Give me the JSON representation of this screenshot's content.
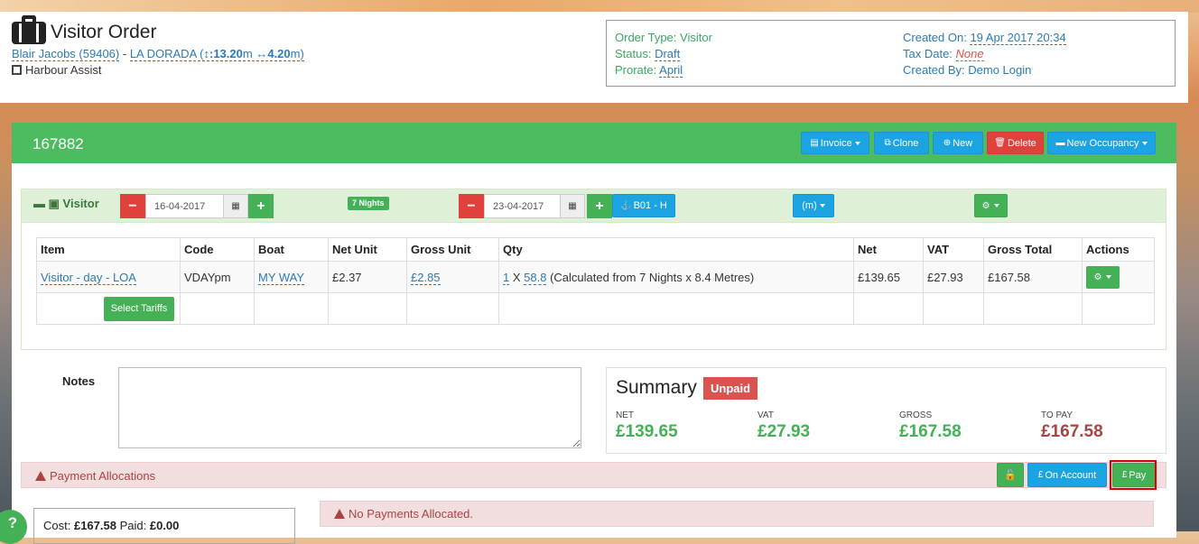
{
  "header": {
    "title": "Visitor Order",
    "customer_link": "Blair Jacobs (59406)",
    "separator": "-",
    "boat_link": "LA DORADA",
    "boat_dims_open": "(",
    "length_icon": "↕",
    "length": ":13.20",
    "length_unit": "m",
    "beam_icon": "↔",
    "beam": "4.20",
    "beam_unit": "m",
    "dims_close": ")",
    "company": "Harbour Assist",
    "info": {
      "order_type_label": "Order Type: Visitor",
      "status_label": "Status:",
      "status_value": "Draft",
      "prorate_label": "Prorate:",
      "prorate_value": "April",
      "created_on_label": "Created On:",
      "created_on_value": "19 Apr 2017 20:34",
      "tax_date_label": "Tax Date:",
      "tax_date_value": "None",
      "created_by_label": "Created By: Demo Login"
    }
  },
  "order": {
    "number": "167882",
    "buttons": {
      "invoice": "Invoice",
      "clone": "Clone",
      "new": "New",
      "delete": "Delete",
      "new_occupancy": "New Occupancy"
    }
  },
  "booking": {
    "label": "Visitor",
    "start_date": "16-04-2017",
    "end_date": "23-04-2017",
    "nights_badge": "7 Nights",
    "berth": "B01 - H",
    "unit_dropdown": "(m)",
    "minus": "−",
    "plus": "+"
  },
  "items_table": {
    "headers": [
      "Item",
      "Code",
      "Boat",
      "Net Unit",
      "Gross Unit",
      "Qty",
      "Net",
      "VAT",
      "Gross Total",
      "Actions"
    ],
    "row": {
      "item": "Visitor - day - LOA",
      "code": "VDAYpm",
      "boat": "MY WAY",
      "net_unit": "£2.37",
      "gross_unit": "£2.85",
      "qty_count": "1",
      "qty_x": "X",
      "qty_value": "58.8",
      "qty_note": "(Calculated from 7 Nights x 8.4 Metres)",
      "net": "£139.65",
      "vat": "£27.93",
      "gross_total": "£167.58"
    },
    "select_tariffs": "Select Tariffs"
  },
  "notes": {
    "label": "Notes",
    "value": ""
  },
  "summary": {
    "title": "Summary",
    "badge": "Unpaid",
    "net_label": "NET",
    "net_value": "£139.65",
    "vat_label": "VAT",
    "vat_value": "£27.93",
    "gross_label": "GROSS",
    "gross_value": "£167.58",
    "topay_label": "TO PAY",
    "topay_value": "£167.58"
  },
  "payments": {
    "title": "Payment Allocations",
    "on_account": "On Account",
    "pay": "Pay",
    "cost_label": "Cost:",
    "cost_value": "£167.58",
    "paid_label": "Paid:",
    "paid_value": "£0.00",
    "none_message": "No Payments Allocated."
  },
  "help": {
    "label": "?"
  },
  "colors": {
    "accent_green": "#4dbb5f",
    "button_blue": "#1ba3e2",
    "danger_red": "#e0413d",
    "link_blue": "#2a7ab8"
  }
}
